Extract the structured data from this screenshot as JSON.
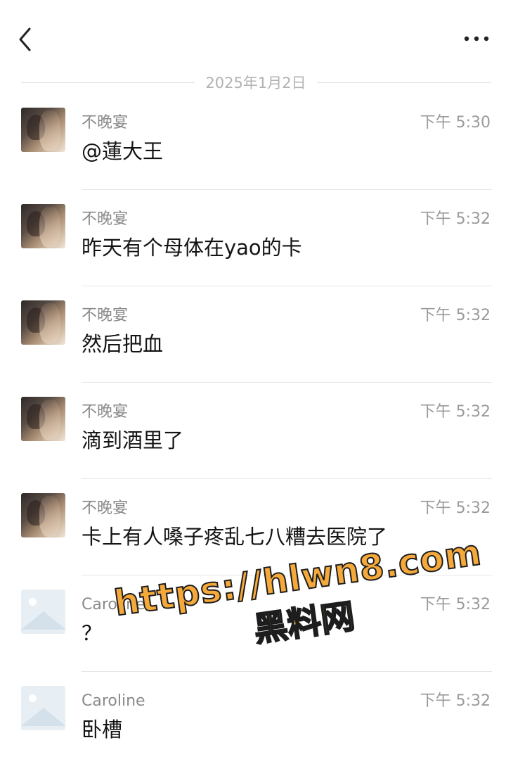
{
  "header": {
    "back_icon": "chevron-left-icon",
    "more_icon": "more-horizontal-icon"
  },
  "date_separator": "2025年1月2日",
  "messages": [
    {
      "sender": "不晚宴",
      "time": "下午 5:30",
      "text": "@蓮大王",
      "avatar": "photo"
    },
    {
      "sender": "不晚宴",
      "time": "下午 5:32",
      "text": "昨天有个母体在yao的卡",
      "avatar": "photo"
    },
    {
      "sender": "不晚宴",
      "time": "下午 5:32",
      "text": "然后把血",
      "avatar": "photo"
    },
    {
      "sender": "不晚宴",
      "time": "下午 5:32",
      "text": "滴到酒里了",
      "avatar": "photo"
    },
    {
      "sender": "不晚宴",
      "time": "下午 5:32",
      "text": "卡上有人嗓子疼乱七八糟去医院了",
      "avatar": "photo"
    },
    {
      "sender": "Caroline",
      "time": "下午 5:32",
      "text": "？",
      "avatar": "placeholder"
    },
    {
      "sender": "Caroline",
      "time": "下午 5:32",
      "text": "卧槽",
      "avatar": "placeholder"
    }
  ],
  "watermark": {
    "line1": "https://hlwn8.com",
    "line2": "黑料网",
    "color": "#f6a93b"
  },
  "colors": {
    "background": "#ffffff",
    "meta_text": "#8a8a8a",
    "divider": "#e6e6e6"
  }
}
